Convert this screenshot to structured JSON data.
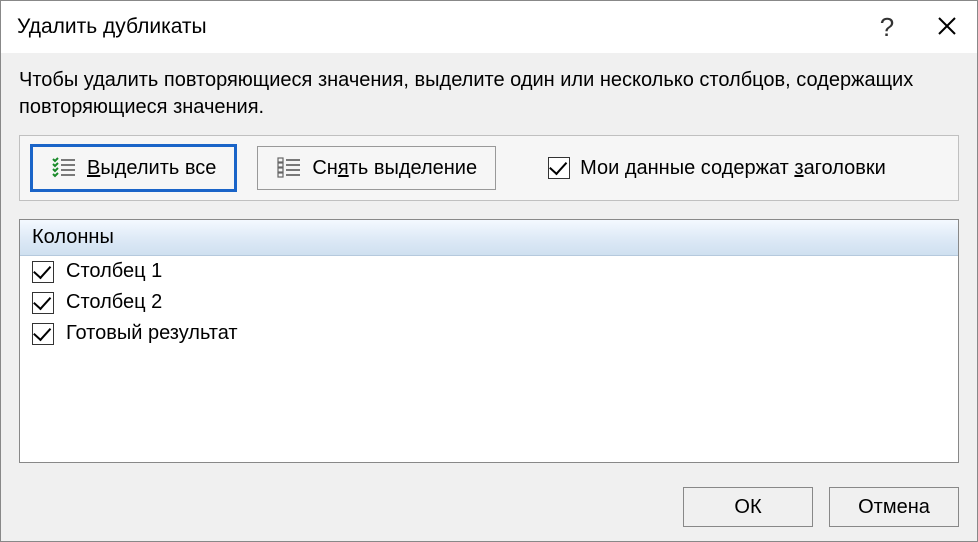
{
  "title": "Удалить дубликаты",
  "help_label": "?",
  "close_label": "✕",
  "instruction": "Чтобы удалить повторяющиеся значения, выделите один или несколько столбцов, содержащих повторяющиеся значения.",
  "buttons": {
    "select_all_prefix": "В",
    "select_all_rest": "ыделить все",
    "unselect_prefix": "Сн",
    "unselect_mid": "я",
    "unselect_rest": "ть выделение"
  },
  "header_checkbox": {
    "prefix": "Мои данные содержат ",
    "hot": "з",
    "rest": "аголовки",
    "checked": true
  },
  "columns_header": "Колонны",
  "columns": [
    {
      "label": "Столбец 1",
      "checked": true
    },
    {
      "label": "Столбец 2",
      "checked": true
    },
    {
      "label": "Готовый результат",
      "checked": true
    }
  ],
  "footer": {
    "ok": "ОК",
    "cancel": "Отмена"
  }
}
